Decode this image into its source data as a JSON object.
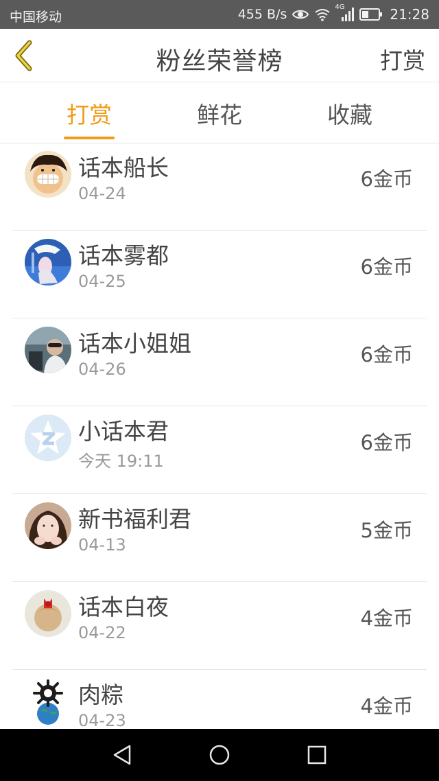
{
  "status_bar": {
    "carrier": "中国移动",
    "net_speed": "455 B/s",
    "network_type": "4G",
    "time": "21:28",
    "icons": [
      "eye-icon",
      "wifi-icon",
      "signal-icon",
      "battery-icon"
    ]
  },
  "header": {
    "title": "粉丝荣誉榜",
    "action_label": "打赏",
    "back_icon": "chevron-left-icon"
  },
  "tabs": [
    {
      "label": "打赏",
      "active": true
    },
    {
      "label": "鲜花",
      "active": false
    },
    {
      "label": "收藏",
      "active": false
    }
  ],
  "colors": {
    "accent": "#f29a16",
    "status_bar": "#5a5a5a",
    "nav_bar": "#000000"
  },
  "list": [
    {
      "name": "话本船长",
      "date": "04-24",
      "amount": "6金币",
      "avatar": "cartoon-avatar"
    },
    {
      "name": "话本雾都",
      "date": "04-25",
      "amount": "6金币",
      "avatar": "photo-avatar"
    },
    {
      "name": "话本小姐姐",
      "date": "04-26",
      "amount": "6金币",
      "avatar": "photo-avatar"
    },
    {
      "name": "小话本君",
      "date": "今天 19:11",
      "amount": "6金币",
      "avatar": "default-avatar"
    },
    {
      "name": "新书福利君",
      "date": "04-13",
      "amount": "5金币",
      "avatar": "photo-avatar"
    },
    {
      "name": "话本白夜",
      "date": "04-22",
      "amount": "4金币",
      "avatar": "photo-avatar"
    },
    {
      "name": "肉粽",
      "date": "04-23",
      "amount": "4金币",
      "avatar": "illustration-avatar"
    }
  ],
  "nav_bar": {
    "buttons": [
      "back-triangle-icon",
      "home-circle-icon",
      "recents-square-icon"
    ]
  }
}
